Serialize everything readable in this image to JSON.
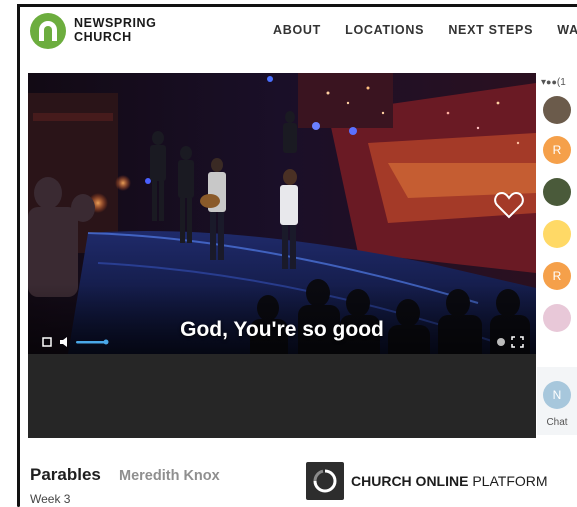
{
  "brand": {
    "name_line1": "NEWSPRING",
    "name_line2": "CHURCH",
    "logo_color": "#6cad3e"
  },
  "nav": {
    "items": [
      "ABOUT",
      "LOCATIONS",
      "NEXT STEPS",
      "WATC"
    ]
  },
  "video": {
    "lyric": "God, You're so good"
  },
  "sidebar": {
    "viewer_count": "(1",
    "avatars": [
      {
        "initial": "",
        "color": "#6b5b4b"
      },
      {
        "initial": "R",
        "color": "#f5a04a"
      },
      {
        "initial": "",
        "color": "#4a5a3a"
      },
      {
        "initial": "",
        "color": "#ffd966"
      },
      {
        "initial": "R",
        "color": "#f5a04a"
      },
      {
        "initial": "",
        "color": "#e8c8d8"
      },
      {
        "initial": "N",
        "color": "#a7c7dc"
      }
    ],
    "chat_label": "Chat"
  },
  "sermon": {
    "title": "Parables",
    "speaker": "Meredith Knox",
    "week": "Week 3"
  },
  "platform": {
    "bold_text": "CHURCH ONLINE",
    "light_text": " PLATFORM"
  }
}
